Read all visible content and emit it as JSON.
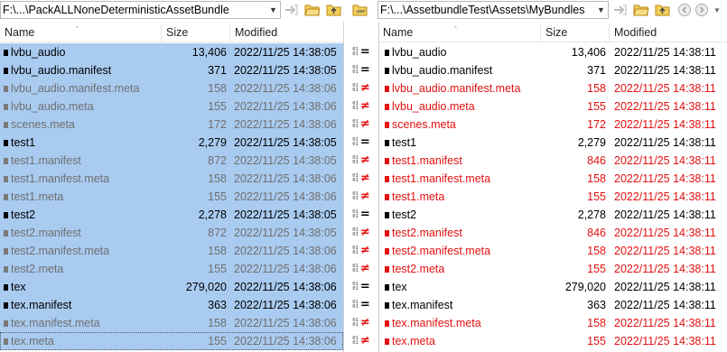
{
  "left_path": "F:\\...\\PackALLNoneDeterministicAssetBundle",
  "right_path": "F:\\...\\AssetbundleTest\\Assets\\MyBundles",
  "columns": {
    "name": "Name",
    "size": "Size",
    "modified": "Modified"
  },
  "icons": {
    "left_toolbar": [
      "swap-icon",
      "folder-open-icon",
      "folder-up-icon",
      "folder-sync-icon"
    ],
    "right_toolbar": [
      "swap-icon",
      "folder-open-icon",
      "folder-up-icon",
      "back-icon",
      "forward-icon"
    ]
  },
  "rows": [
    {
      "name": "lvbu_audio",
      "lsize": "13,406",
      "ldate": "2022/11/25 14:38:05",
      "rsize": "13,406",
      "rdate": "2022/11/25 14:38:11",
      "rel": "=",
      "bits": [
        "01",
        "01"
      ],
      "lstyle": "normal",
      "rstyle": "normal"
    },
    {
      "name": "lvbu_audio.manifest",
      "lsize": "371",
      "ldate": "2022/11/25 14:38:05",
      "rsize": "371",
      "rdate": "2022/11/25 14:38:11",
      "rel": "=",
      "bits": [
        "01",
        "01"
      ],
      "lstyle": "normal",
      "rstyle": "normal"
    },
    {
      "name": "lvbu_audio.manifest.meta",
      "lsize": "158",
      "ldate": "2022/11/25 14:38:06",
      "rsize": "158",
      "rdate": "2022/11/25 14:38:11",
      "rel": "≠",
      "bits": [
        "01",
        "01"
      ],
      "lstyle": "gray",
      "rstyle": "red"
    },
    {
      "name": "lvbu_audio.meta",
      "lsize": "155",
      "ldate": "2022/11/25 14:38:06",
      "rsize": "155",
      "rdate": "2022/11/25 14:38:11",
      "rel": "≠",
      "bits": [
        "01",
        "01"
      ],
      "lstyle": "gray",
      "rstyle": "red"
    },
    {
      "name": "scenes.meta",
      "lsize": "172",
      "ldate": "2022/11/25 14:38:06",
      "rsize": "172",
      "rdate": "2022/11/25 14:38:11",
      "rel": "≠",
      "bits": [
        "01",
        "01"
      ],
      "lstyle": "gray",
      "rstyle": "red"
    },
    {
      "name": "test1",
      "lsize": "2,279",
      "ldate": "2022/11/25 14:38:05",
      "rsize": "2,279",
      "rdate": "2022/11/25 14:38:11",
      "rel": "=",
      "bits": [
        "01",
        "01"
      ],
      "lstyle": "normal",
      "rstyle": "normal"
    },
    {
      "name": "test1.manifest",
      "lsize": "872",
      "ldate": "2022/11/25 14:38:05",
      "rsize": "846",
      "rdate": "2022/11/25 14:38:11",
      "rel": "≠",
      "bits": [
        "01",
        "01"
      ],
      "lstyle": "gray",
      "rstyle": "red"
    },
    {
      "name": "test1.manifest.meta",
      "lsize": "158",
      "ldate": "2022/11/25 14:38:06",
      "rsize": "158",
      "rdate": "2022/11/25 14:38:11",
      "rel": "≠",
      "bits": [
        "01",
        "01"
      ],
      "lstyle": "gray",
      "rstyle": "red"
    },
    {
      "name": "test1.meta",
      "lsize": "155",
      "ldate": "2022/11/25 14:38:06",
      "rsize": "155",
      "rdate": "2022/11/25 14:38:11",
      "rel": "≠",
      "bits": [
        "01",
        "01"
      ],
      "lstyle": "gray",
      "rstyle": "red"
    },
    {
      "name": "test2",
      "lsize": "2,278",
      "ldate": "2022/11/25 14:38:05",
      "rsize": "2,278",
      "rdate": "2022/11/25 14:38:11",
      "rel": "=",
      "bits": [
        "01",
        "01"
      ],
      "lstyle": "normal",
      "rstyle": "normal"
    },
    {
      "name": "test2.manifest",
      "lsize": "872",
      "ldate": "2022/11/25 14:38:05",
      "rsize": "846",
      "rdate": "2022/11/25 14:38:11",
      "rel": "≠",
      "bits": [
        "01",
        "01"
      ],
      "lstyle": "gray",
      "rstyle": "red"
    },
    {
      "name": "test2.manifest.meta",
      "lsize": "158",
      "ldate": "2022/11/25 14:38:06",
      "rsize": "158",
      "rdate": "2022/11/25 14:38:11",
      "rel": "≠",
      "bits": [
        "01",
        "01"
      ],
      "lstyle": "gray",
      "rstyle": "red"
    },
    {
      "name": "test2.meta",
      "lsize": "155",
      "ldate": "2022/11/25 14:38:06",
      "rsize": "155",
      "rdate": "2022/11/25 14:38:11",
      "rel": "≠",
      "bits": [
        "01",
        "01"
      ],
      "lstyle": "gray",
      "rstyle": "red"
    },
    {
      "name": "tex",
      "lsize": "279,020",
      "ldate": "2022/11/25 14:38:06",
      "rsize": "279,020",
      "rdate": "2022/11/25 14:38:11",
      "rel": "=",
      "bits": [
        "01",
        "01"
      ],
      "lstyle": "normal",
      "rstyle": "normal"
    },
    {
      "name": "tex.manifest",
      "lsize": "363",
      "ldate": "2022/11/25 14:38:06",
      "rsize": "363",
      "rdate": "2022/11/25 14:38:11",
      "rel": "=",
      "bits": [
        "01",
        "01"
      ],
      "lstyle": "normal",
      "rstyle": "normal"
    },
    {
      "name": "tex.manifest.meta",
      "lsize": "158",
      "ldate": "2022/11/25 14:38:06",
      "rsize": "158",
      "rdate": "2022/11/25 14:38:11",
      "rel": "≠",
      "bits": [
        "01",
        "01"
      ],
      "lstyle": "gray",
      "rstyle": "red"
    },
    {
      "name": "tex.meta",
      "lsize": "155",
      "ldate": "2022/11/25 14:38:06",
      "rsize": "155",
      "rdate": "2022/11/25 14:38:11",
      "rel": "≠",
      "bits": [
        "01",
        "01"
      ],
      "lstyle": "gray",
      "rstyle": "red"
    }
  ]
}
